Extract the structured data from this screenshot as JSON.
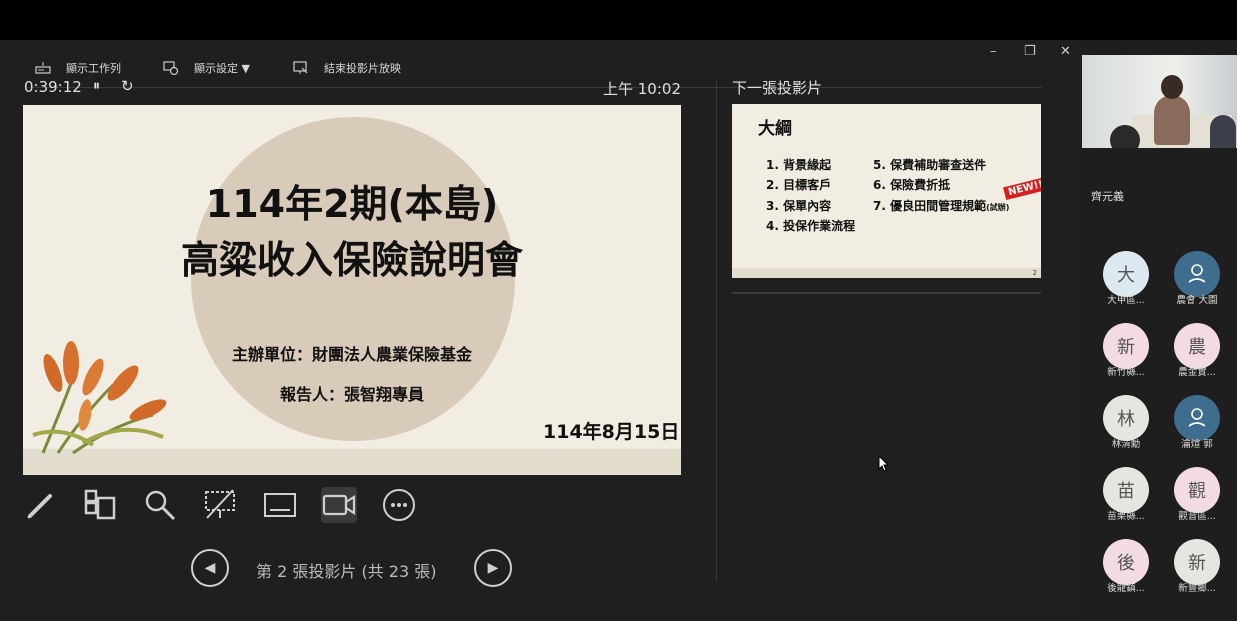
{
  "toolbar": {
    "taskbar_label": "顯示工作列",
    "display_settings_label": "顯示設定 ▼",
    "end_show_label": "結束投影片放映"
  },
  "window": {
    "minimize": "–",
    "restore": "❐",
    "close": "✕"
  },
  "status": {
    "timer": "0:39:12",
    "pause_glyph": "⏸",
    "reset_glyph": "↻",
    "clock": "上午 10:02"
  },
  "current_slide": {
    "title_line1": "114年2期(本島)",
    "title_line2": "高粱收入保險說明會",
    "organizer": "主辦單位：財團法人農業保險基金",
    "reporter": "報告人：張智翔專員",
    "date": "114年8月15日"
  },
  "next_slide": {
    "label": "下一張投影片",
    "title": "大綱",
    "items_left": [
      "1.  背景緣起",
      "2.  目標客戶",
      "3.  保單內容",
      "4.  投保作業流程"
    ],
    "items_right": [
      "5.  保費補助審查送件",
      "6.  保險費折抵",
      "7.  優良田間管理規範"
    ],
    "trial_suffix": "(試辦)",
    "badge": "NEW!!",
    "page_number": "2"
  },
  "navigation": {
    "prev_glyph": "◀",
    "next_glyph": "▶",
    "counter": "第 2 張投影片 (共 23 張)"
  },
  "meeting": {
    "video_participant": "齊元義",
    "participants": [
      {
        "initial": "大",
        "name": "大甲區...",
        "color": "#dde9f0"
      },
      {
        "initial": "",
        "name": "農會 大園",
        "color": "#3f6d8e"
      },
      {
        "initial": "新",
        "name": "新竹縣...",
        "color": "#f3dbe4"
      },
      {
        "initial": "農",
        "name": "農金實...",
        "color": "#f3dbe4"
      },
      {
        "initial": "林",
        "name": "林清勳",
        "color": "#e6e6e0"
      },
      {
        "initial": "",
        "name": "瀹煊 郭",
        "color": "#3f6d8e"
      },
      {
        "initial": "苗",
        "name": "苗栗縣...",
        "color": "#e6e6e0"
      },
      {
        "initial": "觀",
        "name": "觀音區...",
        "color": "#f3dbe4"
      },
      {
        "initial": "後",
        "name": "後龍鎮...",
        "color": "#f3dbe4"
      },
      {
        "initial": "新",
        "name": "新豐鄉...",
        "color": "#e6e6e0"
      }
    ]
  }
}
